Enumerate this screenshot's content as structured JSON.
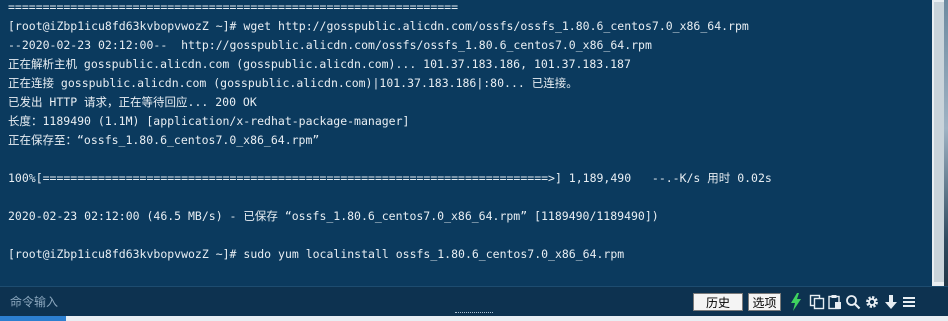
{
  "terminal": {
    "lines": [
      "=================================================================",
      "[root@iZbp1icu8fd63kvbopvwozZ ~]# wget http://gosspublic.alicdn.com/ossfs/ossfs_1.80.6_centos7.0_x86_64.rpm",
      "--2020-02-23 02:12:00--  http://gosspublic.alicdn.com/ossfs/ossfs_1.80.6_centos7.0_x86_64.rpm",
      "正在解析主机 gosspublic.alicdn.com (gosspublic.alicdn.com)... 101.37.183.186, 101.37.183.187",
      "正在连接 gosspublic.alicdn.com (gosspublic.alicdn.com)|101.37.183.186|:80... 已连接。",
      "已发出 HTTP 请求，正在等待回应... 200 OK",
      "长度：1189490 (1.1M) [application/x-redhat-package-manager]",
      "正在保存至：“ossfs_1.80.6_centos7.0_x86_64.rpm”",
      "",
      "100%[=========================================================================>] 1,189,490   --.-K/s 用时 0.02s",
      "",
      "2020-02-23 02:12:00 (46.5 MB/s) - 已保存 “ossfs_1.80.6_centos7.0_x86_64.rpm” [1189490/1189490])",
      "",
      "[root@iZbp1icu8fd63kvbopvwozZ ~]# sudo yum localinstall ossfs_1.80.6_centos7.0_x86_64.rpm",
      ""
    ]
  },
  "command_bar": {
    "placeholder": "命令输入",
    "history_label": "历史",
    "options_label": "选项",
    "icons": [
      "lightning-icon",
      "copy-icon",
      "paste-icon",
      "search-icon",
      "gear-icon",
      "download-icon",
      "menu-icon"
    ]
  },
  "colors": {
    "terminal_bg": "#0b3a5e",
    "terminal_text": "#e8eef3",
    "accent_green": "#3fd25f"
  }
}
